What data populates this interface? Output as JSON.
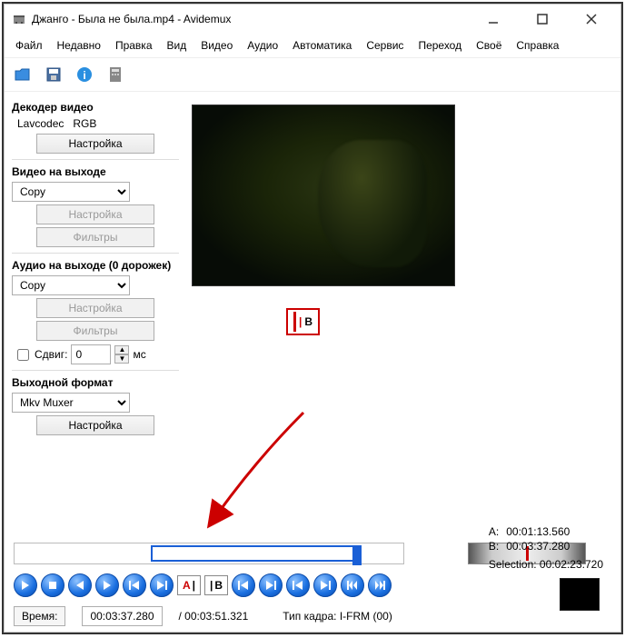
{
  "window": {
    "title": "Джанго - Была не была.mp4 - Avidemux"
  },
  "menu": {
    "file": "Файл",
    "recent": "Недавно",
    "edit": "Правка",
    "view": "Вид",
    "video": "Видео",
    "audio": "Аудио",
    "auto": "Автоматика",
    "service": "Сервис",
    "go": "Переход",
    "custom": "Своё",
    "help": "Справка"
  },
  "decoder": {
    "heading": "Декодер видео",
    "codec": "Lavcodec",
    "colorspace": "RGB",
    "configure": "Настройка"
  },
  "videoOut": {
    "heading": "Видео на выходе",
    "value": "Copy",
    "configure": "Настройка",
    "filters": "Фильтры"
  },
  "audioOut": {
    "heading": "Аудио на выходе (0 дорожек)",
    "value": "Copy",
    "configure": "Настройка",
    "filters": "Фильтры"
  },
  "shift": {
    "label": "Сдвиг:",
    "value": "0",
    "unit": "мс"
  },
  "outputFormat": {
    "heading": "Выходной формат",
    "value": "Mkv Muxer",
    "configure": "Настройка"
  },
  "markers": {
    "aLabel": "A:",
    "bLabel": "B:",
    "a": "00:01:13.560",
    "b": "00:03:37.280",
    "selectionLabel": "Selection:",
    "selection": "00:02:23.720"
  },
  "time": {
    "label": "Время:",
    "current": "00:03:37.280",
    "total": "/ 00:03:51.321",
    "frameTypeLabel": "Тип кадра:",
    "frameType": "I-FRM (00)"
  },
  "highlight": {
    "b_letter": "B"
  }
}
